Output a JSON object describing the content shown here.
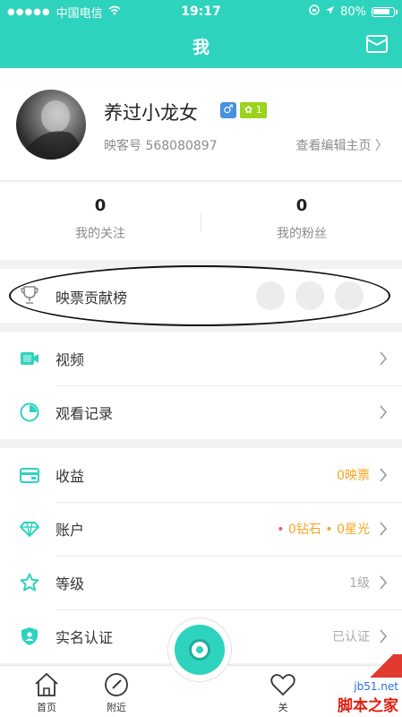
{
  "status_bar": {
    "carrier": "中国电信",
    "time": "19:17",
    "battery": "80%"
  },
  "nav": {
    "title": "我"
  },
  "profile": {
    "name": "养过小龙女",
    "gender_symbol": "♂",
    "level_badge": "✿ 1",
    "uid": "映客号 568080897",
    "edit_link": "查看编辑主页 〉"
  },
  "stats": [
    {
      "count": "0",
      "label": "我的关注"
    },
    {
      "count": "0",
      "label": "我的粉丝"
    }
  ],
  "ranking": {
    "label": "映票贡献榜"
  },
  "menu_group_1": [
    {
      "label": "视频",
      "value": ""
    },
    {
      "label": "观看记录",
      "value": ""
    }
  ],
  "menu_group_2": [
    {
      "label": "收益",
      "value": "0映票"
    },
    {
      "label": "账户",
      "value": "• 0钻石 • 0星光"
    },
    {
      "label": "等级",
      "value": "1级"
    },
    {
      "label": "实名认证",
      "value": "已认证"
    }
  ],
  "tabbar": {
    "home": "首页",
    "nearby": "附近",
    "fourth": "关"
  },
  "watermark": {
    "site": "jb51.net",
    "brand": "脚本之家"
  },
  "colors": {
    "accent": "#2ed3be",
    "orange": "#f5a623",
    "pink": "#ff4f8b"
  }
}
